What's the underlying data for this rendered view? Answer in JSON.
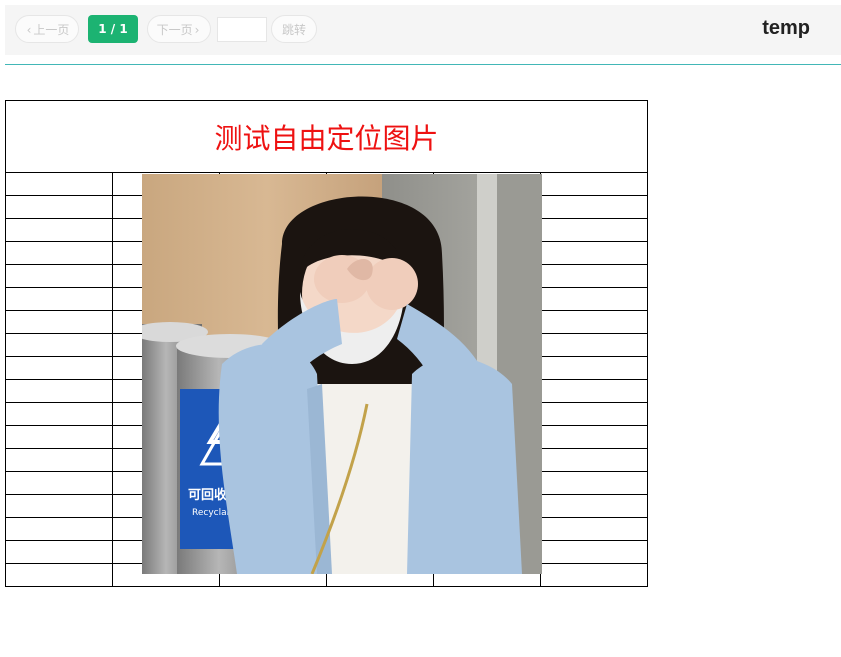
{
  "toolbar": {
    "prev_label": "上一页",
    "page_indicator": "1 / 1",
    "next_label": "下一页",
    "jump_input_value": "",
    "jump_label": "跳转",
    "doc_name": "temp"
  },
  "colors": {
    "accent": "#1cb372",
    "divider": "#42b7b7",
    "title_red": "#ee1111"
  },
  "sheet": {
    "title": "测试自由定位图片",
    "columns": 6,
    "data_rows": 18
  },
  "photo": {
    "sign_line1": "可回收物",
    "sign_line2": "Recyclable"
  }
}
